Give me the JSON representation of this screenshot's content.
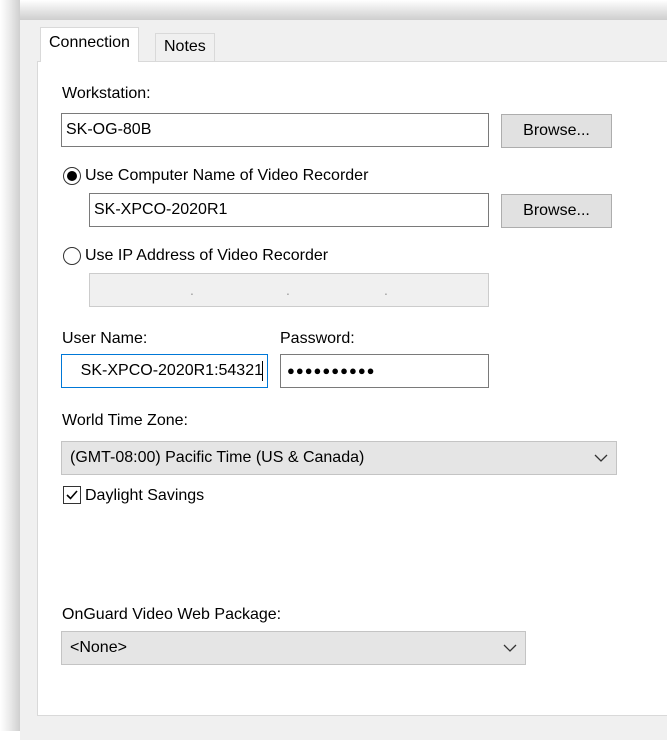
{
  "tabs": [
    {
      "label": "Connection",
      "active": true
    },
    {
      "label": "Notes",
      "active": false
    }
  ],
  "workstation": {
    "label": "Workstation:",
    "value": "SK-OG-80B",
    "browse_label": "Browse..."
  },
  "computer_name_option": {
    "label": "Use Computer Name of Video Recorder",
    "selected": true,
    "value": "SK-XPCO-2020R1",
    "browse_label": "Browse..."
  },
  "ip_option": {
    "label": "Use IP Address of Video Recorder",
    "selected": false,
    "separator": "."
  },
  "credentials": {
    "username_label": "User Name:",
    "username_value": "SK-XPCO-2020R1:54321",
    "password_label": "Password:",
    "password_value": "●●●●●●●●●●"
  },
  "time_zone": {
    "label": "World Time Zone:",
    "selected": "(GMT-08:00) Pacific Time (US & Canada)"
  },
  "daylight_savings": {
    "label": "Daylight Savings",
    "checked": true
  },
  "web_package": {
    "label": "OnGuard Video Web Package:",
    "selected": "<None>"
  },
  "icons": {
    "dropdown": "chevron-down-icon",
    "check": "checkmark-icon"
  },
  "colors": {
    "focus_border": "#0078d7",
    "window_bg": "#f0f0f0",
    "panel_bg": "#ffffff",
    "button_bg": "#e1e1e1"
  }
}
